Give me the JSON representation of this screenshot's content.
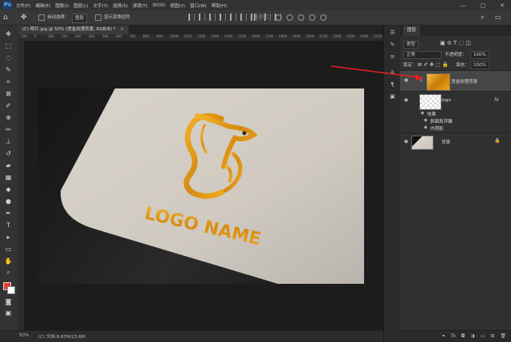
{
  "menubar": {
    "app_logo": "Ps",
    "items": [
      "文件(F)",
      "编辑(E)",
      "图像(I)",
      "图层(L)",
      "文字(Y)",
      "选择(S)",
      "滤镜(T)",
      "3D(D)",
      "视图(V)",
      "窗口(W)",
      "帮助(H)"
    ],
    "win_minimize": "—",
    "win_maximize": "□",
    "win_close": "✕"
  },
  "options": {
    "auto_select_label": "自动选择：",
    "auto_select_value": "图层",
    "show_transform_label": "显示变换控件",
    "mode3d_label": "3D 模式："
  },
  "document": {
    "tab_title": "(C) 明片.jpg @ 50% (烫金纹理背景, RGB/8) *",
    "close": "×"
  },
  "ruler": {
    "ticks": [
      "100",
      "0",
      "100",
      "200",
      "300",
      "400",
      "500",
      "600",
      "700",
      "800",
      "900",
      "1000",
      "1100",
      "1200",
      "1300",
      "1400",
      "1500",
      "1600",
      "1700",
      "1800",
      "1900",
      "2000",
      "2100",
      "2200",
      "2300",
      "2400",
      "2500"
    ]
  },
  "artwork": {
    "logo_text": "LOGO NAME"
  },
  "status": {
    "zoom": "50%",
    "doc_info": "(C) 文档:6.87M/23.6M"
  },
  "layers_panel": {
    "tab_label": "图层",
    "filter_label": "类型",
    "blend_mode": "正常",
    "opacity_label": "不透明度：",
    "opacity_value": "100%",
    "lock_label": "锁定：",
    "fill_label": "填充：",
    "fill_value": "100%",
    "layers": [
      {
        "name": "烫金纹理背景",
        "selected": true
      },
      {
        "name": "logo",
        "fx": "fx"
      },
      {
        "name": "效果",
        "sub": true
      },
      {
        "name": "斜面和浮雕",
        "sub": true
      },
      {
        "name": "内阴影",
        "sub": true
      },
      {
        "name": "背景"
      }
    ],
    "footer_icons": [
      "link-icon",
      "fx-icon",
      "mask-icon",
      "adjustment-icon",
      "group-icon",
      "new-layer-icon",
      "trash-icon"
    ]
  },
  "colors": {
    "foreground": "#e8392d",
    "background": "#ffffff",
    "accent": "#e07a1a",
    "gold": "#e6a018"
  }
}
